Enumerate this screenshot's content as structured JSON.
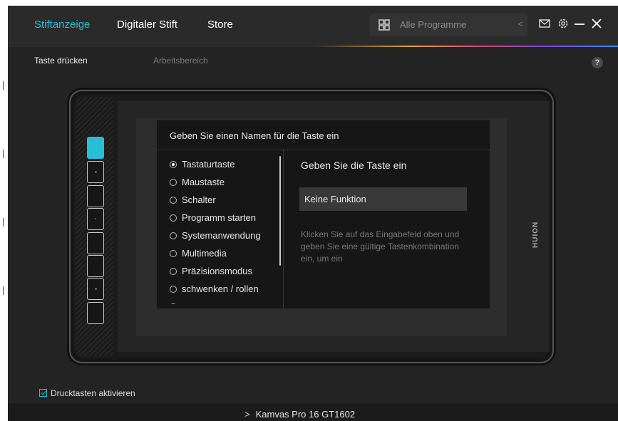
{
  "nav": {
    "tabs": [
      {
        "label": "Stiftanzeige",
        "active": true
      },
      {
        "label": "Digitaler Stift",
        "active": false
      },
      {
        "label": "Store",
        "active": false
      }
    ],
    "search_placeholder": "Alle Programme",
    "search_back": "<",
    "icons": [
      "grid-icon",
      "mail-icon",
      "settings-icon",
      "minimize-icon",
      "close-icon"
    ]
  },
  "subtabs": [
    {
      "label": "Taste drücken",
      "active": true
    },
    {
      "label": "Arbeitsbereich",
      "active": false
    }
  ],
  "help_label": "?",
  "tablet": {
    "brand": "HUION",
    "keys": 8,
    "active_key": 1
  },
  "dialog": {
    "title": "Geben Sie einen Namen für die Taste ein",
    "options": [
      {
        "label": "Tastaturtaste",
        "selected": true
      },
      {
        "label": "Maustaste",
        "selected": false
      },
      {
        "label": "Schalter",
        "selected": false
      },
      {
        "label": "Programm starten",
        "selected": false
      },
      {
        "label": "Systemanwendung",
        "selected": false
      },
      {
        "label": "Multimedia",
        "selected": false
      },
      {
        "label": "Präzisionsmodus",
        "selected": false
      },
      {
        "label": "schwenken / rollen",
        "selected": false
      }
    ],
    "right_title": "Geben Sie die Taste ein",
    "key_value": "Keine Funktion",
    "hint": "Klicken Sie auf das Eingabefeld oben und geben Sie eine gültige Tastenkombination ein, um ein"
  },
  "footer": {
    "enable_label": "Drucktasten aktivieren",
    "enable_checked": true,
    "device_label": "Kamvas Pro 16 GT1602",
    "device_chevron": ">"
  },
  "colors": {
    "accent": "#25c0d8",
    "background": "#232323"
  }
}
